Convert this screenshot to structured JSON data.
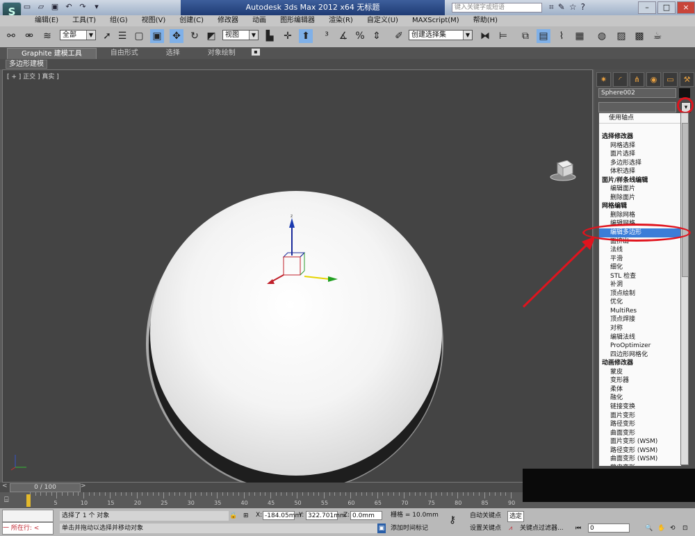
{
  "titlebar": {
    "title": "Autodesk 3ds Max  2012 x64      无标题",
    "search_placeholder": "键入关键字或短语",
    "quick_access": [
      "new-icon",
      "open-icon",
      "save-icon",
      "undo-icon",
      "redo-icon",
      "dropdown-icon"
    ],
    "right_icons": [
      "binoculars-icon",
      "wrench-icon",
      "star-icon",
      "help-icon"
    ],
    "win_min": "–",
    "win_max": "□",
    "win_close": "×"
  },
  "app_logo": "S",
  "menu": [
    "编辑(E)",
    "工具(T)",
    "组(G)",
    "视图(V)",
    "创建(C)",
    "修改器",
    "动画",
    "图形编辑器",
    "渲染(R)",
    "自定义(U)",
    "MAXScript(M)",
    "帮助(H)"
  ],
  "toolbar": {
    "selection_filter": "全部",
    "ref_coord": "视图",
    "named_selection": "创建选择集"
  },
  "ribbon": {
    "tabs": [
      "Graphite 建模工具",
      "自由形式",
      "选择",
      "对象绘制"
    ],
    "active_tab": "Graphite 建模工具",
    "sub_label": "多边形建模"
  },
  "viewport": {
    "label": "[ + ] 正交 ] 真实 ]"
  },
  "command_panel": {
    "object_name": "Sphere002",
    "swatch_color": "#111111",
    "dropdown_first": "使用轴点",
    "modifier_list": [
      {
        "t": "选择修改器",
        "h": true
      },
      {
        "t": "网格选择"
      },
      {
        "t": "面片选择"
      },
      {
        "t": "多边形选择"
      },
      {
        "t": "体积选择"
      },
      {
        "t": "面片/样条线编辑",
        "h": true
      },
      {
        "t": "编辑面片"
      },
      {
        "t": "删除面片"
      },
      {
        "t": "网格编辑",
        "h": true
      },
      {
        "t": "删除网格"
      },
      {
        "t": "编辑网格"
      },
      {
        "t": "编辑多边形",
        "sel": true
      },
      {
        "t": "面挤出"
      },
      {
        "t": "法线"
      },
      {
        "t": "平滑"
      },
      {
        "t": "细化"
      },
      {
        "t": "STL 检查"
      },
      {
        "t": "补洞"
      },
      {
        "t": "顶点绘制"
      },
      {
        "t": "优化"
      },
      {
        "t": "MultiRes"
      },
      {
        "t": "顶点焊接"
      },
      {
        "t": "对称"
      },
      {
        "t": "编辑法线"
      },
      {
        "t": "ProOptimizer"
      },
      {
        "t": "四边形网格化"
      },
      {
        "t": "动画修改器",
        "h": true
      },
      {
        "t": "蒙皮"
      },
      {
        "t": "变形器"
      },
      {
        "t": "柔体"
      },
      {
        "t": "融化"
      },
      {
        "t": "链接变换"
      },
      {
        "t": "面片变形"
      },
      {
        "t": "路径变形"
      },
      {
        "t": "曲面变形"
      },
      {
        "t": "面片变形 (WSM)"
      },
      {
        "t": "路径变形 (WSM)"
      },
      {
        "t": "曲面变形 (WSM)"
      },
      {
        "t": "蒙皮变形"
      }
    ]
  },
  "timeline": {
    "frame": "0 / 100",
    "ticks": [
      "5",
      "10",
      "15",
      "20",
      "25",
      "30",
      "35",
      "40",
      "45",
      "50",
      "55",
      "60",
      "65",
      "70",
      "75",
      "80",
      "85",
      "90"
    ]
  },
  "status": {
    "maxscript_text": "一  所在行:  <",
    "line1": "选择了 1 个 对象",
    "line2": "单击并拖动以选择并移动对象",
    "x_label": "X:",
    "x_value": "-184.05mm",
    "y_label": "Y:",
    "y_value": "322.701mm",
    "z_label": "Z:",
    "z_value": "0.0mm",
    "grid": "栅格 = 10.0mm",
    "auto_key": "自动关键点",
    "selected": "选定",
    "set_key": "设置关键点",
    "key_filter": "关键点过滤器...",
    "add_time_tag": "添加时间标记",
    "frame_field": "0"
  },
  "colors": {
    "highlight": "#3b7dd8",
    "annotation": "#e0141e",
    "time_slider": "#e3b92b"
  }
}
